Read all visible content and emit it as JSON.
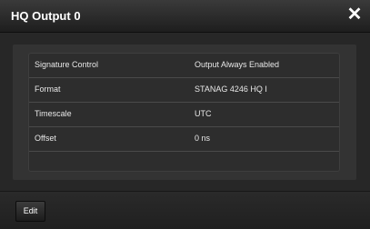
{
  "dialog": {
    "title": "HQ Output 0",
    "close_label": "✕"
  },
  "settings": [
    {
      "label": "Signature Control",
      "value": "Output Always Enabled"
    },
    {
      "label": "Format",
      "value": "STANAG 4246 HQ I"
    },
    {
      "label": "Timescale",
      "value": "UTC"
    },
    {
      "label": "Offset",
      "value": "0 ns"
    }
  ],
  "footer": {
    "edit_label": "Edit"
  }
}
